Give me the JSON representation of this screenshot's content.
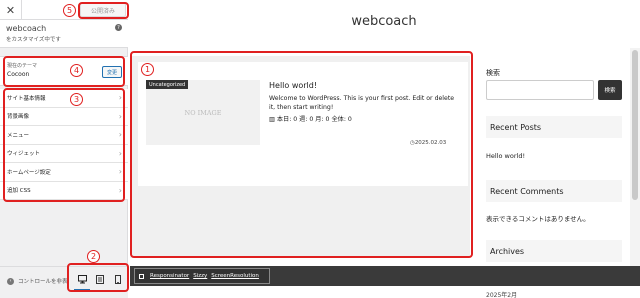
{
  "customizer": {
    "close_glyph": "✕",
    "publish_label": "公開済み",
    "site_name": "webcoach",
    "site_sub": "をカスタマイズ中です",
    "help_glyph": "?",
    "theme_label": "現在のテーマ",
    "theme_name": "Cocoon",
    "change_label": "変更",
    "menu_items": [
      {
        "label": "サイト基本情報"
      },
      {
        "label": "背景画像"
      },
      {
        "label": "メニュー"
      },
      {
        "label": "ウィジェット"
      },
      {
        "label": "ホームページ設定"
      },
      {
        "label": "追加 CSS"
      }
    ],
    "hide_controls_label": "コントロールを非表",
    "devices": [
      "desktop-icon",
      "tablet-icon",
      "mobile-icon"
    ]
  },
  "preview": {
    "site_title": "webcoach",
    "post": {
      "category": "Uncategorized",
      "thumbnail_text": "NO IMAGE",
      "title": "Hello world!",
      "excerpt": "Welcome to WordPress. This is your first post. Edit or delete it, then start writing!",
      "stats": "本日: 0 週: 0 月: 0 全体: 0",
      "date": "2025.02.03"
    },
    "sidebar": {
      "search_label": "検索",
      "search_button": "検索",
      "recent_posts_title": "Recent Posts",
      "recent_post_item": "Hello world!",
      "recent_comments_title": "Recent Comments",
      "recent_comments_text": "表示できるコメントはありません。",
      "archives_title": "Archives",
      "archive_item": "2025年2月"
    },
    "dev_toolbar": {
      "links": [
        "Responsinator",
        "Sizzy",
        "ScreenResolution"
      ]
    }
  },
  "annotations": [
    "1",
    "2",
    "3",
    "4",
    "5"
  ],
  "colors": {
    "annotation_red": "#e02020",
    "accent_blue": "#2271b1",
    "dark_button": "#333333"
  }
}
